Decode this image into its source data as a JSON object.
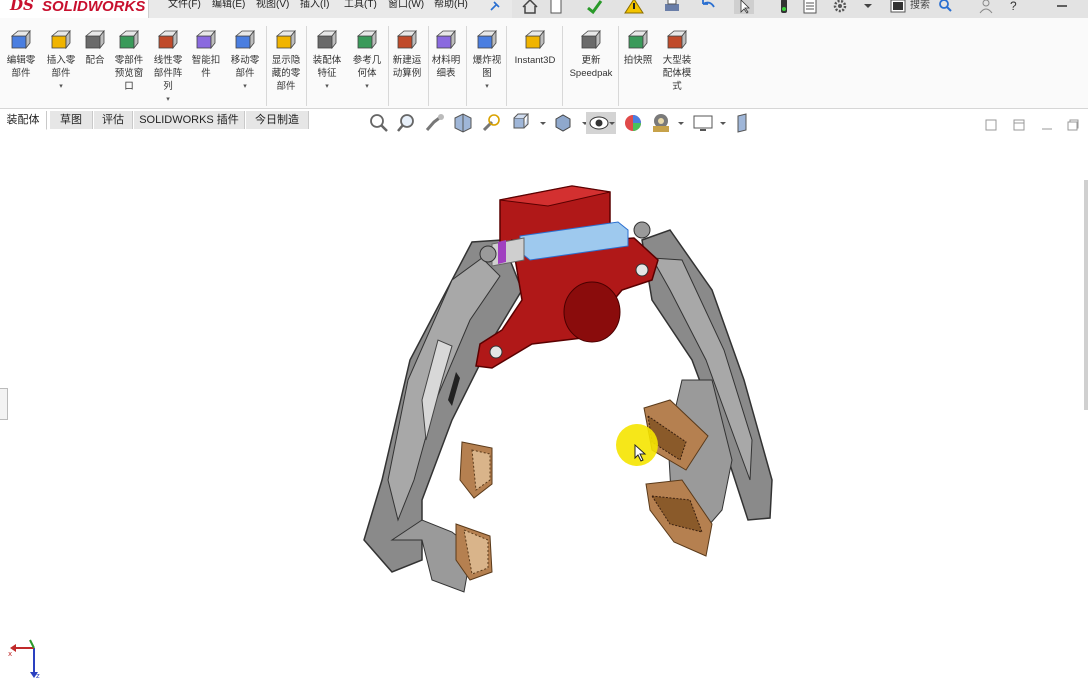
{
  "app": {
    "logo_ds": "DS",
    "logo_name": "SOLIDWORKS"
  },
  "menu": [
    {
      "label": "文件(F)"
    },
    {
      "label": "编辑(E)"
    },
    {
      "label": "视图(V)"
    },
    {
      "label": "插入(I)"
    },
    {
      "label": "工具(T)"
    },
    {
      "label": "窗口(W)"
    },
    {
      "label": "帮助(H)"
    }
  ],
  "search": {
    "label": "搜索"
  },
  "ribbon": {
    "commands": [
      {
        "label": "编辑零\n部件",
        "icon": "edit-component-icon"
      },
      {
        "label": "插入零\n部件",
        "icon": "insert-component-icon",
        "has_arrow": true
      },
      {
        "label": "配合",
        "icon": "mate-icon"
      },
      {
        "label": "零部件\n预览窗\n口",
        "icon": "component-preview-icon"
      },
      {
        "label": "线性零\n部件阵\n列",
        "icon": "linear-pattern-icon",
        "has_arrow": true
      },
      {
        "label": "智能扣\n件",
        "icon": "smart-fasteners-icon"
      },
      {
        "label": "移动零\n部件",
        "icon": "move-component-icon",
        "has_arrow": true
      },
      {
        "label": "显示隐\n藏的零\n部件",
        "icon": "show-hidden-icon"
      },
      {
        "label": "装配体\n特征",
        "icon": "assembly-features-icon",
        "has_arrow": true
      },
      {
        "label": "参考几\n何体",
        "icon": "reference-geometry-icon",
        "has_arrow": true
      },
      {
        "label": "新建运\n动算例",
        "icon": "new-motion-study-icon"
      },
      {
        "label": "材料明\n细表",
        "icon": "bom-icon"
      },
      {
        "label": "爆炸视\n图",
        "icon": "exploded-view-icon",
        "has_arrow": true
      },
      {
        "label": "Instant3D",
        "icon": "instant3d-icon"
      },
      {
        "label": "更新\nSpeedpak",
        "icon": "speedpak-icon"
      },
      {
        "label": "拍快照",
        "icon": "snapshot-icon"
      },
      {
        "label": "大型装\n配体模\n式",
        "icon": "large-assembly-icon"
      }
    ]
  },
  "tabs": [
    {
      "label": "装配体",
      "active": true
    },
    {
      "label": "草图"
    },
    {
      "label": "评估"
    },
    {
      "label": "SOLIDWORKS 插件"
    },
    {
      "label": "今日制造"
    }
  ],
  "colors": {
    "accent_red": "#c8102e",
    "part_red": "#b01818",
    "part_gray": "#8a8a8a",
    "pad_brown": "#b58050",
    "cursor_highlight": "#f5e400"
  }
}
